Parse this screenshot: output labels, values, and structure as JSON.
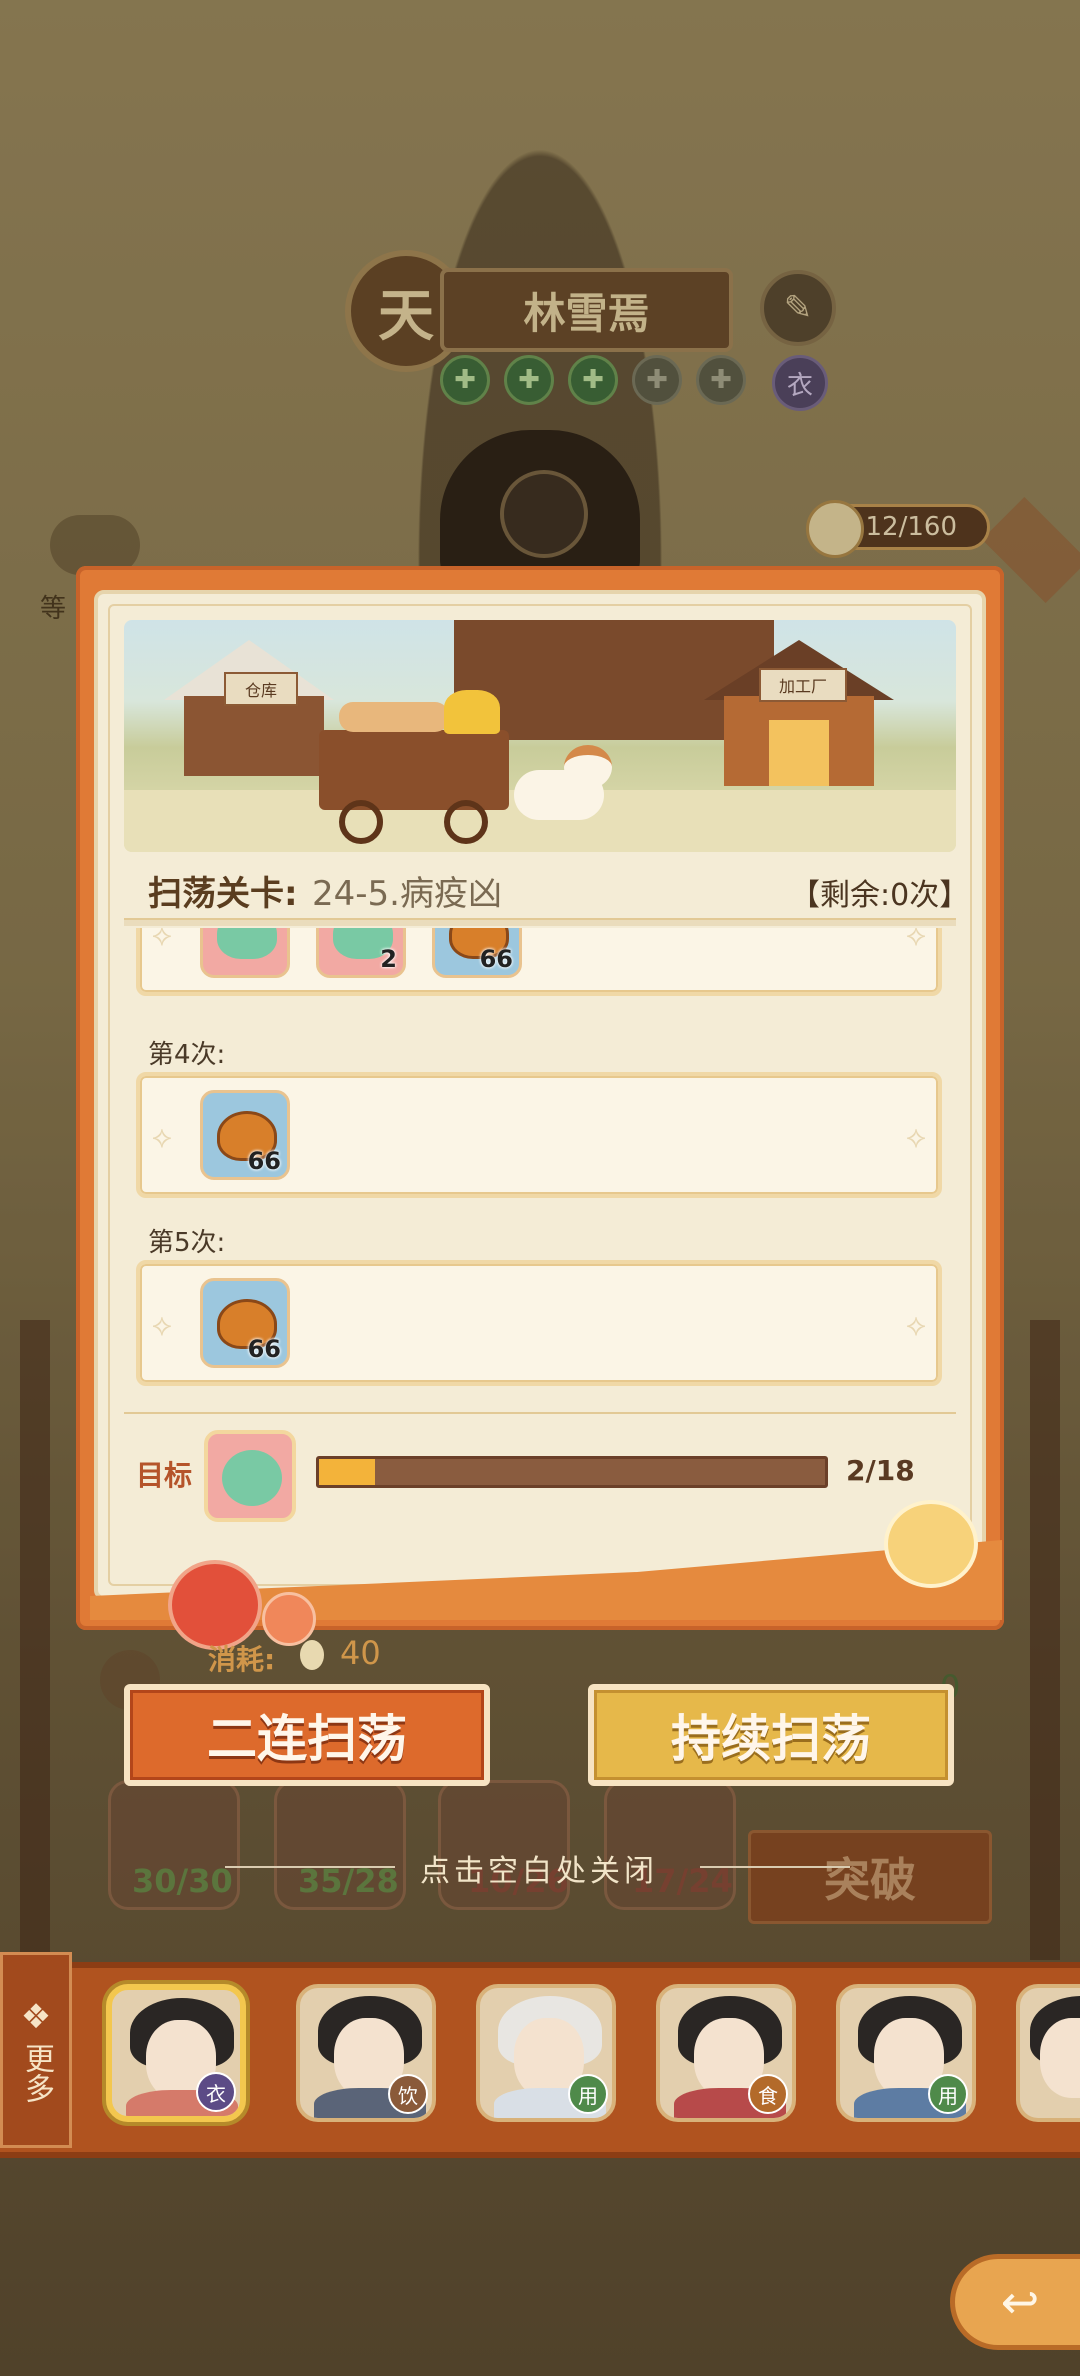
{
  "header": {
    "rank_badge": "天",
    "character_name": "林雪焉",
    "clothing_tag": "衣",
    "stars": [
      "✚",
      "✚",
      "✚",
      "✚",
      "✚"
    ],
    "energy": "12/160",
    "side_label": "等"
  },
  "popup": {
    "scene_labels": {
      "warehouse": "仓库",
      "factory": "加工厂"
    },
    "sweep_title": "扫荡关卡:",
    "stage_name": "24-5.病疫凶",
    "remaining": "【剩余:0次】",
    "rows": [
      {
        "label": "",
        "items": [
          {
            "type": "red",
            "count": ""
          },
          {
            "type": "red",
            "count": "2"
          },
          {
            "type": "blue",
            "count": "66"
          }
        ]
      },
      {
        "label": "第4次:",
        "items": [
          {
            "type": "blue",
            "count": "66"
          }
        ]
      },
      {
        "label": "第5次:",
        "items": [
          {
            "type": "blue",
            "count": "66"
          }
        ]
      }
    ],
    "target": {
      "label": "目标",
      "progress_text": "2/18",
      "progress_current": 2,
      "progress_total": 18
    },
    "cost_label": "消耗:",
    "cost_value": "40",
    "btn_double": "二连扫荡",
    "btn_continuous": "持续扫荡"
  },
  "background": {
    "cards": [
      "30/30",
      "35/28",
      "10/26",
      "17/24"
    ],
    "breakthrough": "突破",
    "green_text": "0"
  },
  "close_hint": "点击空白处关闭",
  "bottom_bar": {
    "more_label": "更多",
    "portraits": [
      {
        "tag": "衣"
      },
      {
        "tag": "饮"
      },
      {
        "tag": "用"
      },
      {
        "tag": "食"
      },
      {
        "tag": "用"
      }
    ]
  },
  "colors": {
    "popup_orange": "#e07a36",
    "panel_cream": "#f4ecd6",
    "progress_fill": "#f3b33a",
    "button_orange": "#dd6a2c",
    "button_gold": "#e6b84a"
  }
}
